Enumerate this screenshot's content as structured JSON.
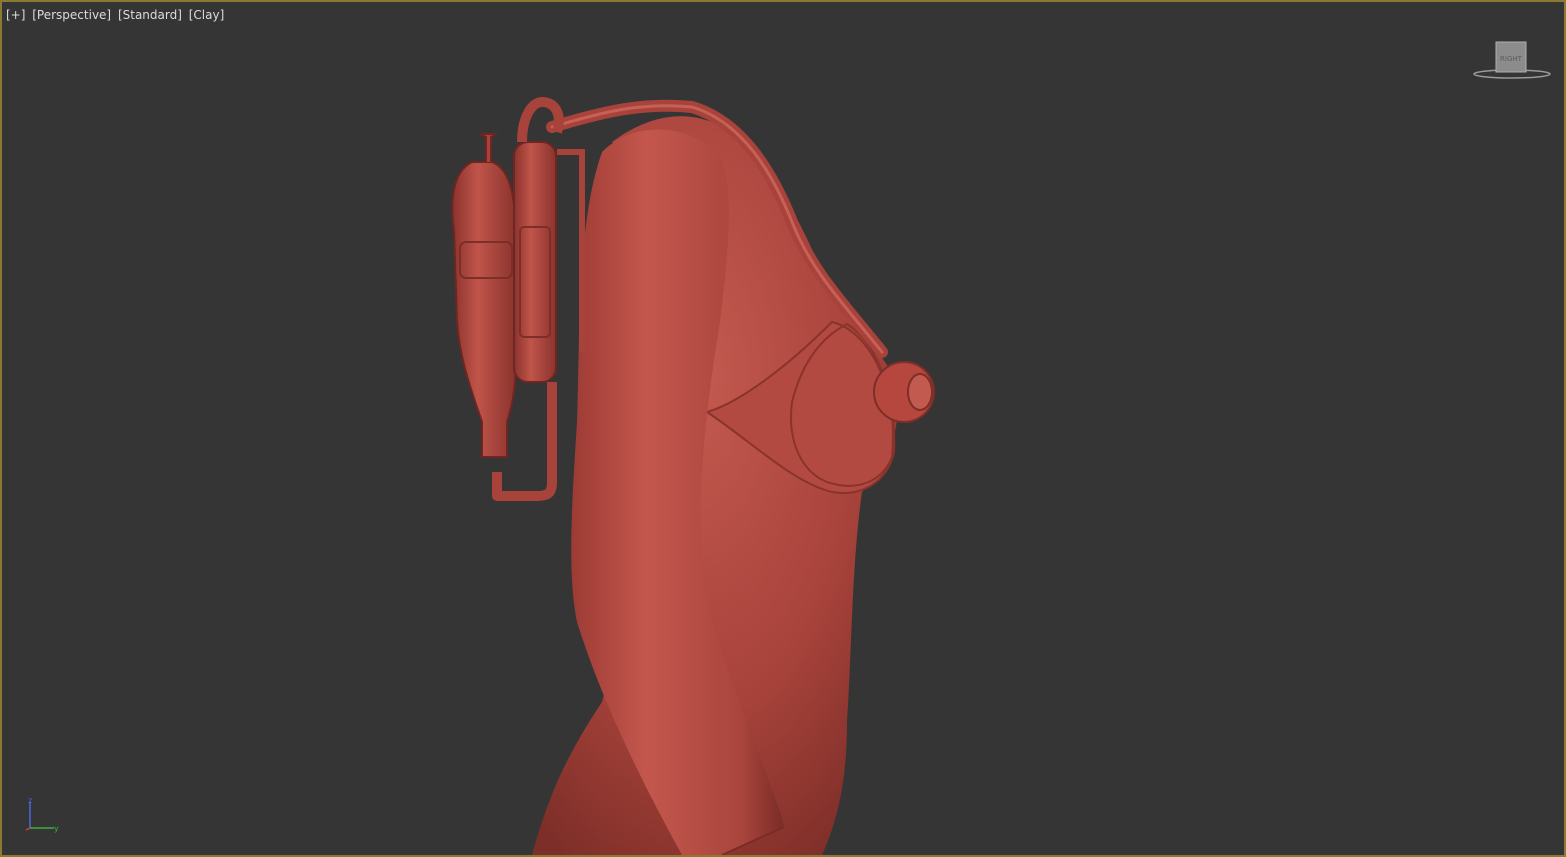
{
  "viewport": {
    "labels": [
      "[+]",
      "[Perspective]",
      "[Standard]",
      "[Clay]"
    ]
  },
  "viewcube": {
    "face_label": "RIGHT"
  },
  "axis_tripod": {
    "z_label": "z",
    "y_label": "y"
  },
  "colors": {
    "viewport_bg": "#353535",
    "border_active": "#8a7a32",
    "clay": "#b9483f",
    "axis_z": "#4a6ad8",
    "axis_y": "#3fae3f",
    "axis_x": "#d83a3a"
  },
  "icons": {
    "viewcube": "viewcube-icon",
    "tripod": "axis-tripod-icon"
  }
}
